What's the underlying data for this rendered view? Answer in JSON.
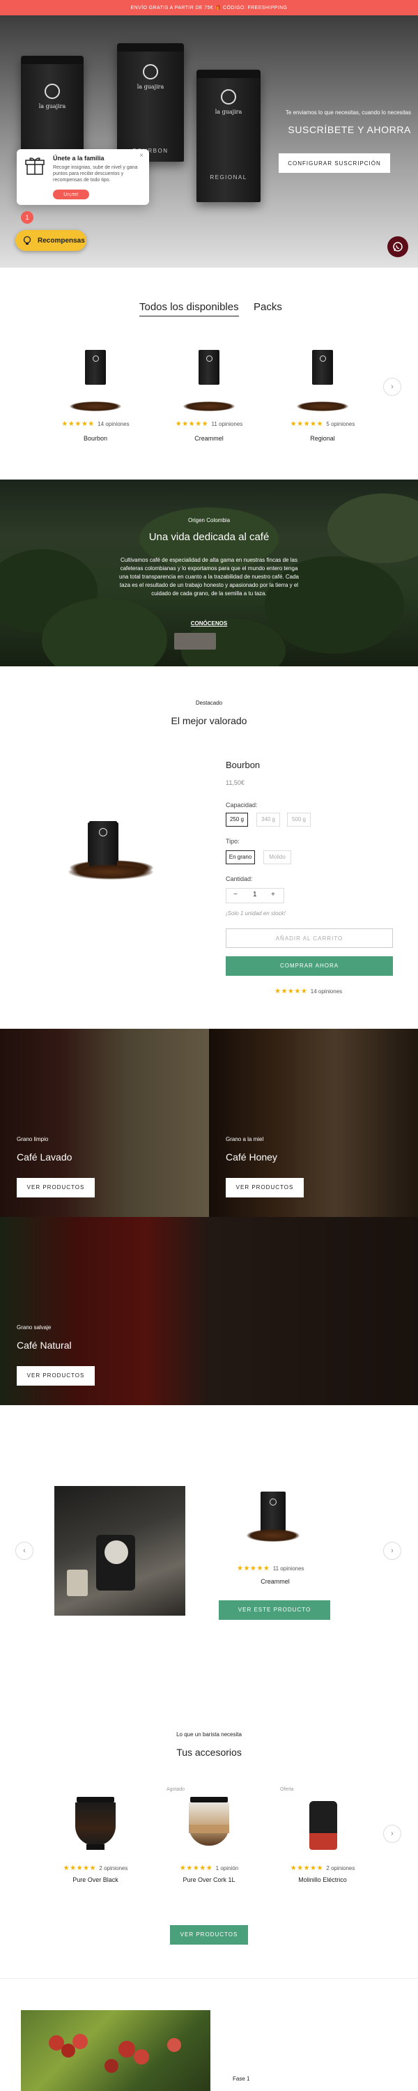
{
  "announcement": "ENVÍO GRATIS A PARTIR DE 75€ 🎁 CÓDIGO: FREESHIPPING",
  "hero": {
    "bags": [
      "la guajira",
      "la guajira",
      "la guajira"
    ],
    "bag_labels": [
      "",
      "BOURBON",
      "REGIONAL"
    ],
    "tagline": "Te enviamos lo que necesitas, cuando lo necesitas",
    "title": "SUSCRÍBETE Y AHORRA",
    "cta": "CONFIGURAR SUSCRIPCIÓN"
  },
  "popup": {
    "title": "Únete a la familia",
    "text": "Recoge insignias, sube de nivel y gana puntos para recibir descuentos y recompensas de todo tipo.",
    "cta": "Un¡rte!",
    "close": "×"
  },
  "badge_count": "1",
  "rewards_label": "Recompensas",
  "catalog": {
    "tabs": [
      "Todos los disponibles",
      "Packs"
    ],
    "products": [
      {
        "name": "Bourbon",
        "stars": "★★★★★",
        "reviews": "14 opiniones"
      },
      {
        "name": "Creammel",
        "stars": "★★★★★",
        "reviews": "11 opiniones"
      },
      {
        "name": "Regional",
        "stars": "★★★★★",
        "reviews": "5 opiniones"
      }
    ],
    "next_arrow": "›"
  },
  "origin": {
    "label": "Origen Colombia",
    "title": "Una vida dedicada al café",
    "text": "Cultivamos café de especialidad de alta gama en nuestras fincas de las cafeteras colombianas y lo exportamos para que el mundo entero tenga una total transparencia en cuanto a la trazabilidad de nuestro café. Cada taza es el resultado de un trabajo honesto y apasionado por la tierra y el cuidado de cada grano, de la semilla a tu taza.",
    "cta": "CONÓCENOS"
  },
  "featured": {
    "label": "Destacado",
    "title": "El mejor valorado",
    "product_name": "Bourbon",
    "price": "11,50€",
    "capacity_label": "Capacidad:",
    "capacities": [
      "250 g",
      "340 g",
      "500 g"
    ],
    "type_label": "Tipo:",
    "types": [
      "En grano",
      "Molido"
    ],
    "qty_label": "Cantidad:",
    "qty": "1",
    "qty_minus": "−",
    "qty_plus": "+",
    "stock_note": "¡Solo 1 unidad en stock!",
    "add_to_cart": "AÑADIR AL CARRITO",
    "buy_now": "COMPRAR AHORA",
    "stars": "★★★★★",
    "reviews": "14 opiniones"
  },
  "categories": [
    {
      "label": "Grano limpio",
      "title": "Café Lavado",
      "cta": "VER PRODUCTOS"
    },
    {
      "label": "Grano a la miel",
      "title": "Café Honey",
      "cta": "VER PRODUCTOS"
    },
    {
      "label": "Grano salvaje",
      "title": "Café Natural",
      "cta": "VER PRODUCTOS"
    }
  ],
  "slider": {
    "product_name": "Creammel",
    "stars": "★★★★★",
    "reviews": "11 opiniones",
    "cta": "VER ESTE PRODUCTO",
    "prev": "‹",
    "next": "›"
  },
  "accessories": {
    "label": "Lo que un barista necesita",
    "title": "Tus accesorios",
    "items": [
      {
        "tag": "",
        "name": "Pure Over Black",
        "stars": "★★★★★",
        "reviews": "2 opiniones"
      },
      {
        "tag": "Agotado",
        "name": "Pure Over Cork 1L",
        "stars": "★★★★★",
        "reviews": "1 opinión"
      },
      {
        "tag": "Oferta",
        "name": "Molinillo Eléctrico",
        "stars": "★★★★★",
        "reviews": "2 opiniones"
      }
    ],
    "cta": "VER PRODUCTOS",
    "next": "›"
  },
  "phase": {
    "label": "Fase 1"
  },
  "colors": {
    "accent_red": "#f25c54",
    "green": "#4aa07a",
    "star": "#f5b301",
    "rewards": "#f5c12e",
    "whatsapp_bg": "#5c0d18"
  }
}
